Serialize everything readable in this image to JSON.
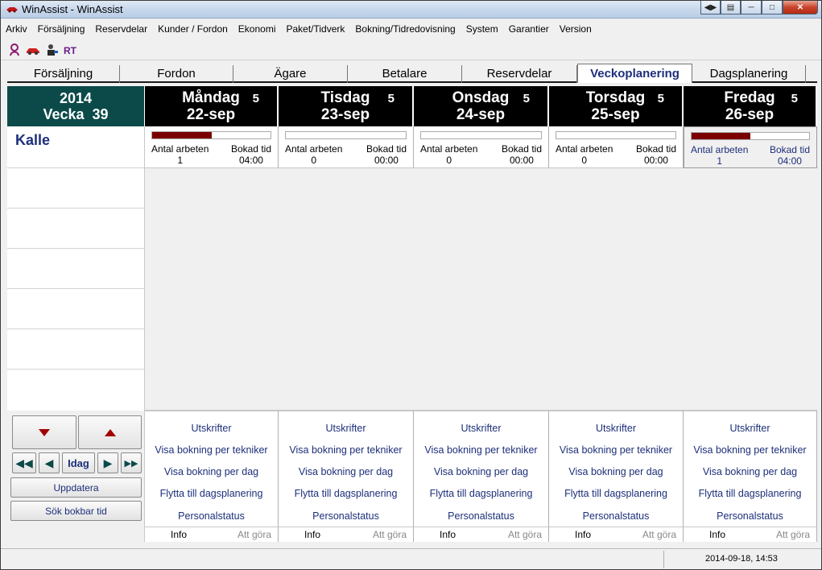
{
  "window": {
    "title": "WinAssist - WinAssist"
  },
  "menu": [
    "Arkiv",
    "Försäljning",
    "Reservdelar",
    "Kunder / Fordon",
    "Ekonomi",
    "Paket/Tidverk",
    "Bokning/Tidredovisning",
    "System",
    "Garantier",
    "Version"
  ],
  "toolbar": {
    "rt_label": "RT"
  },
  "tabs": [
    "Försäljning",
    "Fordon",
    "Ägare",
    "Betalare",
    "Reservdelar",
    "Veckoplanering",
    "Dagsplanering"
  ],
  "active_tab": "Veckoplanering",
  "week": {
    "year": "2014",
    "week_label": "Vecka  39"
  },
  "days": [
    {
      "name": "Måndag",
      "count": "5",
      "date": "22-sep",
      "antal": "1",
      "bokad": "04:00",
      "load": 0.5
    },
    {
      "name": "Tisdag",
      "count": "5",
      "date": "23-sep",
      "antal": "0",
      "bokad": "00:00",
      "load": 0
    },
    {
      "name": "Onsdag",
      "count": "5",
      "date": "24-sep",
      "antal": "0",
      "bokad": "00:00",
      "load": 0
    },
    {
      "name": "Torsdag",
      "count": "5",
      "date": "25-sep",
      "antal": "0",
      "bokad": "00:00",
      "load": 0
    },
    {
      "name": "Fredag",
      "count": "5",
      "date": "26-sep",
      "antal": "1",
      "bokad": "04:00",
      "load": 0.5
    }
  ],
  "stat_labels": {
    "antal": "Antal arbeten",
    "bokad": "Bokad tid"
  },
  "technician": "Kalle",
  "day_links": [
    "Utskrifter",
    "Visa bokning per tekniker",
    "Visa bokning per dag",
    "Flytta till dagsplanering",
    "Personalstatus"
  ],
  "info_labels": {
    "info": "Info",
    "todo": "Att göra"
  },
  "controls": {
    "today": "Idag",
    "update": "Uppdatera",
    "search": "Sök bokbar tid"
  },
  "status": {
    "datetime": "2014-09-18, 14:53"
  }
}
